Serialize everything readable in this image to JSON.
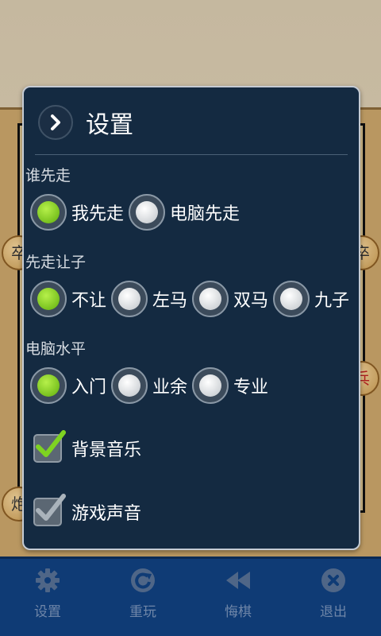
{
  "dialog": {
    "title": "设置",
    "who_first": {
      "label": "谁先走",
      "options": [
        "我先走",
        "电脑先走"
      ],
      "selected": 0
    },
    "handicap": {
      "label": "先走让子",
      "options": [
        "不让",
        "左马",
        "双马",
        "九子"
      ],
      "selected": 0
    },
    "level": {
      "label": "电脑水平",
      "options": [
        "入门",
        "业余",
        "专业"
      ],
      "selected": 0
    },
    "bg_music": {
      "label": "背景音乐",
      "checked": true
    },
    "game_sound": {
      "label": "游戏声音",
      "checked": true
    }
  },
  "bottom_nav": {
    "items": [
      {
        "label": "设置",
        "icon": "gear-icon"
      },
      {
        "label": "重玩",
        "icon": "replay-icon"
      },
      {
        "label": "悔棋",
        "icon": "rewind-icon"
      },
      {
        "label": "退出",
        "icon": "exit-icon"
      }
    ]
  },
  "board": {
    "pieces": [
      "卒",
      "卒",
      "炮",
      "兵"
    ]
  },
  "colors": {
    "dialog_bg": "#142a41",
    "radio_selected": "#7ed321",
    "check_green": "#7ed321",
    "nav_bg": "#0f3b75"
  }
}
